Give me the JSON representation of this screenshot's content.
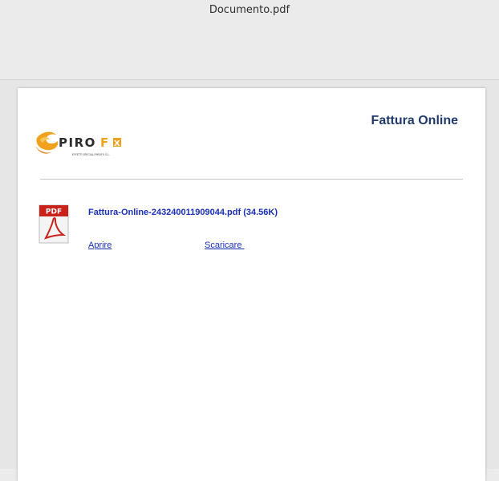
{
  "window": {
    "title": "Documento.pdf"
  },
  "document": {
    "title": "Fattura Online",
    "logo": {
      "brand": "PIROFX",
      "tagline": "EFFETTI SPECIALI PIROFX S.L."
    },
    "attachment": {
      "icon_label": "PDF",
      "filename": "Fattura-Online-243240011909044.pdf (34.56K)",
      "open_label": "Aprire",
      "download_label": "Scaricare "
    }
  },
  "colors": {
    "title": "#1f3a6b",
    "link": "#1a2fb8",
    "pdf_red": "#c8221a",
    "logo_orange": "#f0a21e"
  }
}
